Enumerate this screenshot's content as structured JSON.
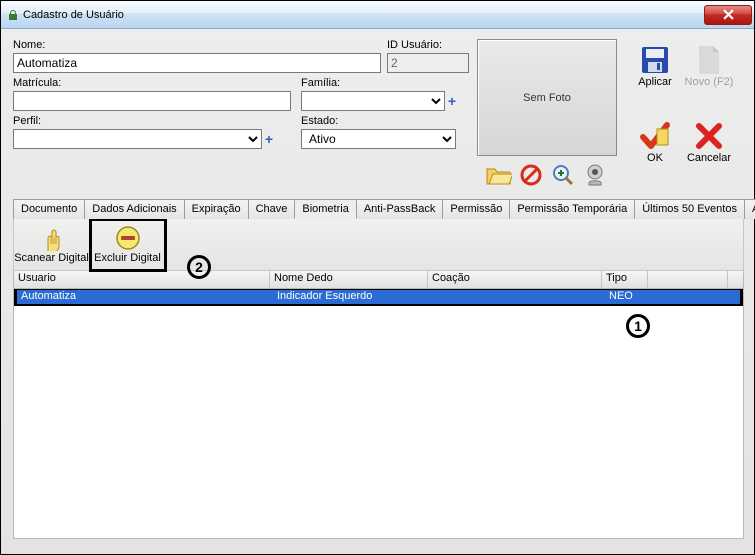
{
  "window": {
    "title": "Cadastro de Usuário"
  },
  "fields": {
    "nome": {
      "label": "Nome:",
      "value": "Automatiza"
    },
    "id": {
      "label": "ID Usuário:",
      "value": "2"
    },
    "matricula": {
      "label": "Matrícula:",
      "value": ""
    },
    "familia": {
      "label": "Família:",
      "value": ""
    },
    "perfil": {
      "label": "Perfil:",
      "value": ""
    },
    "estado": {
      "label": "Estado:",
      "value": "Ativo"
    }
  },
  "photo": {
    "placeholder": "Sem Foto"
  },
  "rightButtons": {
    "aplicar": "Aplicar",
    "novo": "Novo (F2)",
    "ok": "OK",
    "cancelar": "Cancelar"
  },
  "tabs": [
    "Documento",
    "Dados Adicionais",
    "Expiração",
    "Chave",
    "Biometria",
    "Anti-PassBack",
    "Permissão",
    "Permissão Temporária",
    "Últimos 50 Eventos",
    "Acesso"
  ],
  "activeTab": "Biometria",
  "bioToolbar": {
    "scan": "Scanear Digital",
    "delete": "Excluir Digital"
  },
  "grid": {
    "headers": [
      "Usuario",
      "Nome Dedo",
      "Coação",
      "Tipo",
      ""
    ],
    "widths": [
      256,
      158,
      174,
      46,
      80
    ],
    "rows": [
      {
        "usuario": "Automatiza",
        "dedo": "Indicador Esquerdo",
        "coacao": "",
        "tipo": "NEO",
        "selected": true
      }
    ]
  },
  "annotations": {
    "one": "1",
    "two": "2"
  }
}
